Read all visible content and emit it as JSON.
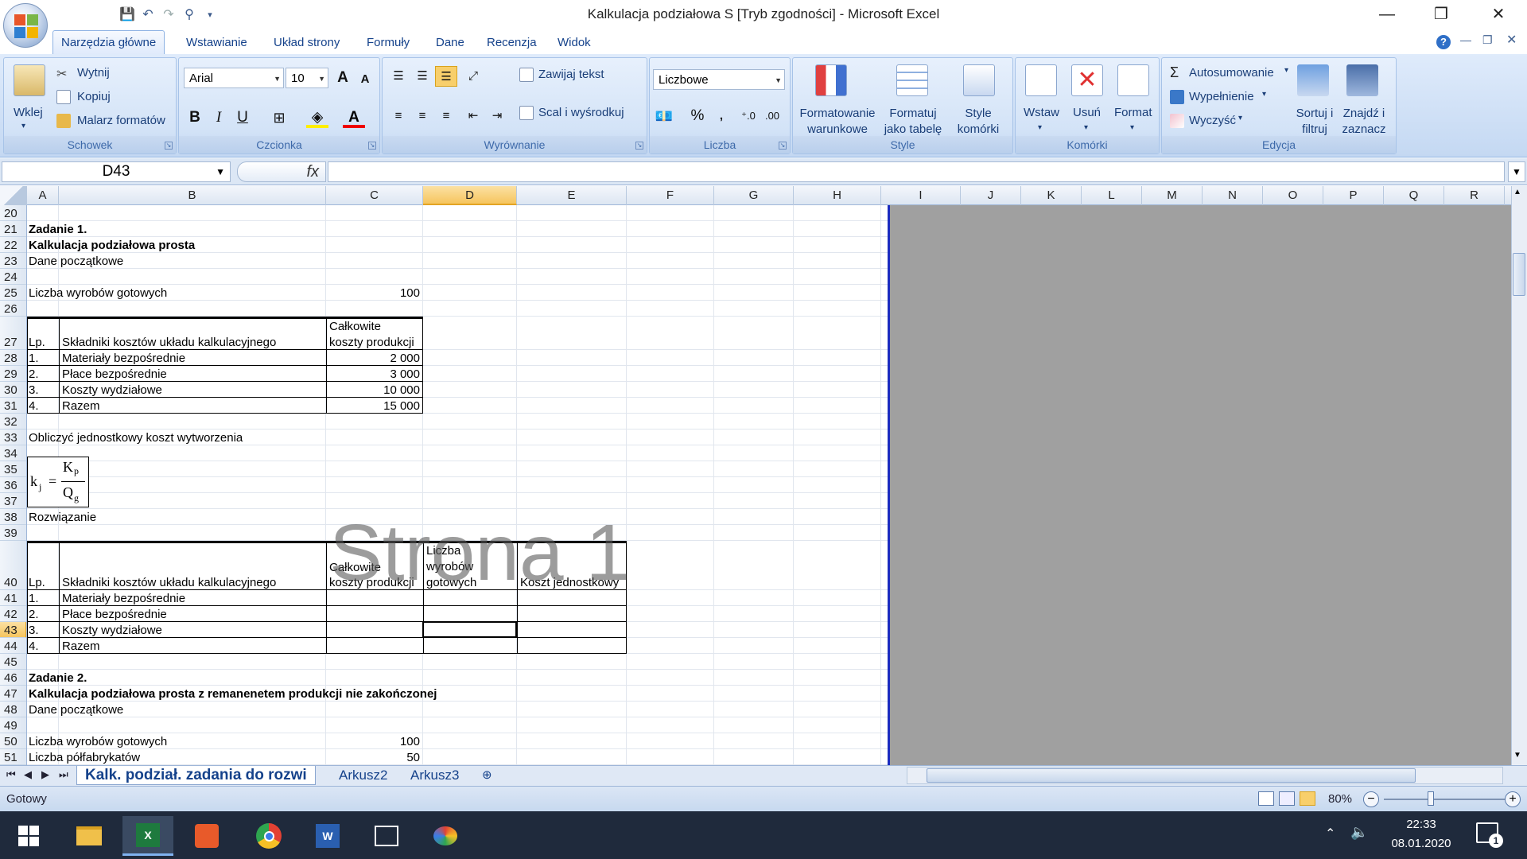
{
  "window": {
    "title": "Kalkulacja podziałowa S  [Tryb zgodności] - Microsoft Excel",
    "min": "—",
    "restore": "❐",
    "close": "✕"
  },
  "qat": {
    "save_icon": "floppy-icon",
    "undo_icon": "undo-icon",
    "redo_icon": "redo-icon",
    "filter_icon": "filter-icon"
  },
  "tabs": [
    "Narzędzia główne",
    "Wstawianie",
    "Układ strony",
    "Formuły",
    "Dane",
    "Recenzja",
    "Widok"
  ],
  "ribbon": {
    "clipboard": {
      "title": "Schowek",
      "paste": "Wklej",
      "cut": "Wytnij",
      "copy": "Kopiuj",
      "painter": "Malarz formatów"
    },
    "font": {
      "title": "Czcionka",
      "name": "Arial",
      "size": "10",
      "bold": "B",
      "italic": "I",
      "underline": "U",
      "grow": "A",
      "shrink": "A"
    },
    "alignment": {
      "title": "Wyrównanie",
      "wrap": "Zawijaj tekst",
      "merge": "Scal i wyśrodkuj"
    },
    "number": {
      "title": "Liczba",
      "format": "Liczbowe",
      "percent": "%",
      "comma": "000"
    },
    "styles": {
      "title": "Style",
      "cond": "Formatowanie warunkowe",
      "table": "Formatuj jako tabelę",
      "cell": "Style komórki"
    },
    "cells": {
      "title": "Komórki",
      "insert": "Wstaw",
      "delete": "Usuń",
      "format": "Format"
    },
    "editing": {
      "title": "Edycja",
      "autosum": "Autosumowanie",
      "fill": "Wypełnienie",
      "clear": "Wyczyść",
      "sort": "Sortuj i filtruj",
      "find": "Znajdź i zaznacz"
    }
  },
  "formula": {
    "namebox": "D43",
    "fx": "fx",
    "value": ""
  },
  "columns": [
    "A",
    "B",
    "C",
    "D",
    "E",
    "F",
    "G",
    "H",
    "I",
    "J",
    "K",
    "L",
    "M",
    "N",
    "O",
    "P",
    "Q",
    "R"
  ],
  "rows": [
    "20",
    "21",
    "22",
    "23",
    "24",
    "25",
    "26",
    "27",
    "28",
    "29",
    "30",
    "31",
    "32",
    "33",
    "34",
    "35",
    "36",
    "37",
    "38",
    "39",
    "40",
    "41",
    "42",
    "43",
    "44",
    "45",
    "46",
    "47",
    "48",
    "49",
    "50",
    "51"
  ],
  "sheet": {
    "z1": "Zadanie 1.",
    "z1_title": "Kalkulacja podziałowa prosta",
    "dane": "Dane początkowe",
    "liczba_label": "Liczba wyrobów gotowych",
    "liczba_val": "100",
    "t1": {
      "lp": "Lp.",
      "skl": "Składniki kosztów układu kalkulacyjnego",
      "calk": [
        "Całkowite",
        "koszty produkcji"
      ],
      "rows": [
        [
          "1.",
          "Materiały bezpośrednie",
          "2 000"
        ],
        [
          "2.",
          "Płace bezpośrednie",
          "3 000"
        ],
        [
          "3.",
          "Koszty wydziałowe",
          "10 000"
        ],
        [
          "4.",
          "Razem",
          "15 000"
        ]
      ]
    },
    "oblicz": "Obliczyć jednostkowy koszt wytworzenia",
    "formula": {
      "k": "k",
      "j": "j",
      "eq": "=",
      "Kp": "K",
      "p": "p",
      "Qg": "Q",
      "g": "g"
    },
    "rozw": "Rozwiązanie",
    "t2": {
      "lp": "Lp.",
      "skl": "Składniki kosztów układu kalkulacyjnego",
      "calk": [
        "Całkowite",
        "koszty produkcji"
      ],
      "liczba": [
        "Liczba",
        "wyrobów",
        "gotowych"
      ],
      "koszt": "Koszt jednostkowy",
      "rows": [
        [
          "1.",
          "Materiały bezpośrednie"
        ],
        [
          "2.",
          "Płace bezpośrednie"
        ],
        [
          "3.",
          "Koszty wydziałowe"
        ],
        [
          "4.",
          "Razem"
        ]
      ]
    },
    "z2": "Zadanie 2.",
    "z2_title": "Kalkulacja podziałowa prosta z remanenetem produkcji nie zakończonej",
    "dane2": "Dane początkowe",
    "liczba2_label": "Liczba wyrobów gotowych",
    "liczba2_val": "100",
    "polf_label": "Liczba półfabrykatów",
    "polf_val": "50",
    "watermark": "Strona 1"
  },
  "sheet_tabs": [
    "Kalk. podział. zadania do rozwi",
    "Arkusz2",
    "Arkusz3"
  ],
  "status": {
    "ready": "Gotowy",
    "zoom": "80%"
  },
  "taskbar": {
    "time": "22:33",
    "date": "08.01.2020",
    "notif": "1"
  }
}
